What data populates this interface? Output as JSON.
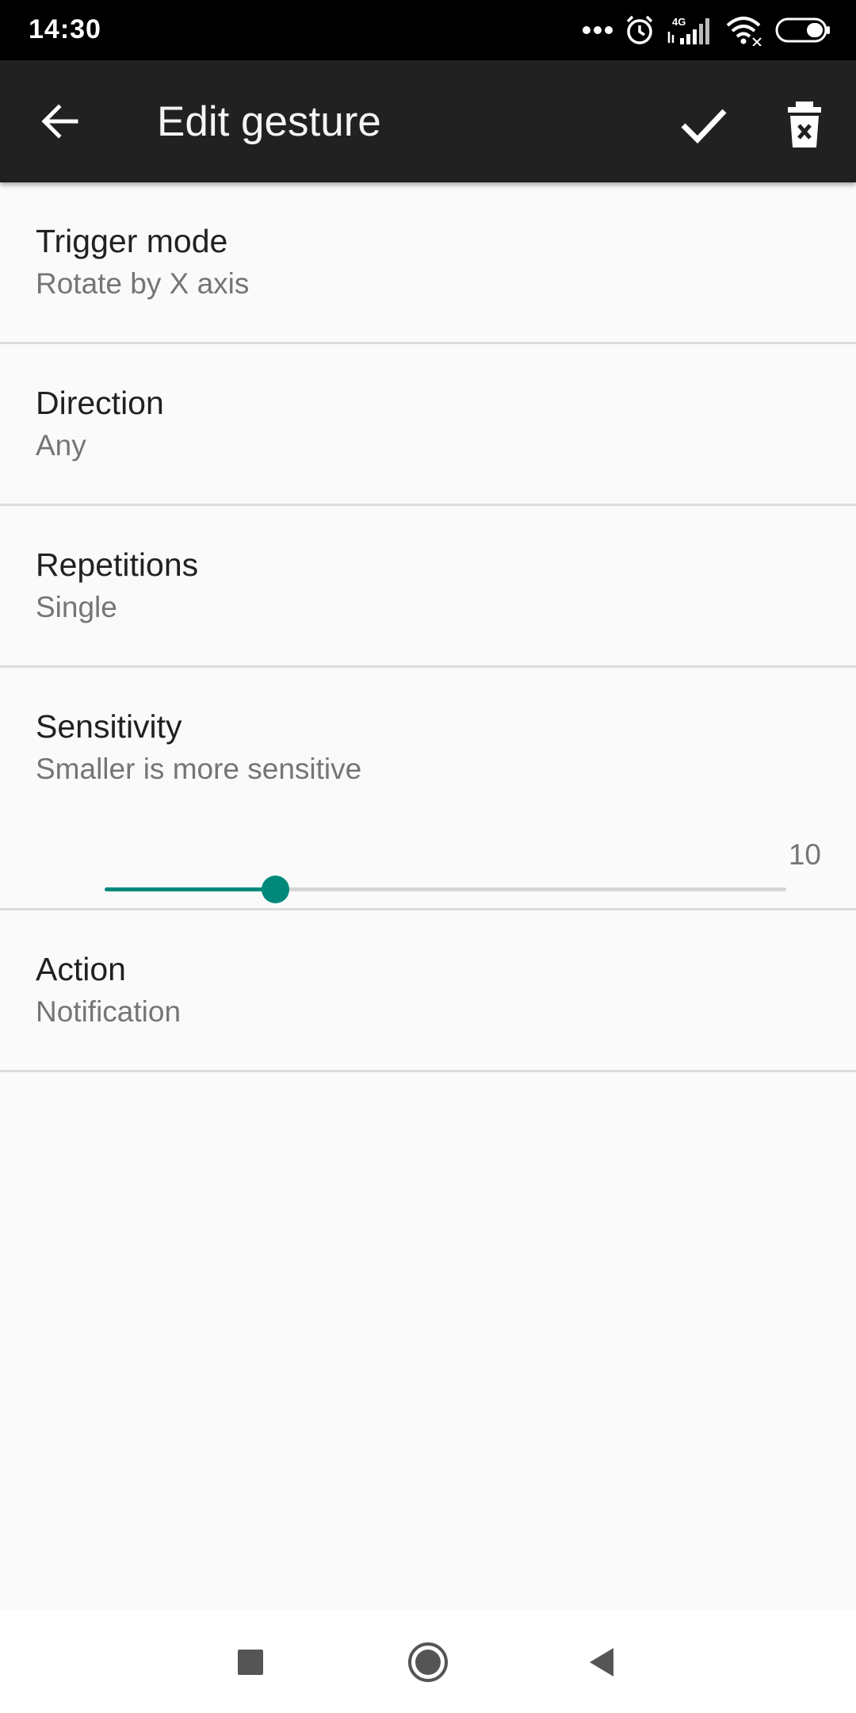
{
  "status_bar": {
    "time": "14:30",
    "network": "4G",
    "icons": [
      "more-dots-icon",
      "alarm-icon",
      "signal-icon",
      "wifi-icon",
      "battery-icon"
    ]
  },
  "app_bar": {
    "title": "Edit gesture",
    "icons": [
      "back-arrow-icon",
      "check-icon",
      "delete-icon"
    ]
  },
  "settings": {
    "trigger_mode": {
      "label": "Trigger mode",
      "value": "Rotate by X axis"
    },
    "direction": {
      "label": "Direction",
      "value": "Any"
    },
    "repetitions": {
      "label": "Repetitions",
      "value": "Single"
    },
    "sensitivity": {
      "label": "Sensitivity",
      "value": "Smaller is more sensitive",
      "slider_value": "10",
      "slider_fraction": 0.25
    },
    "action": {
      "label": "Action",
      "value": "Notification"
    }
  },
  "nav_bar": {
    "icons": [
      "recents-square-icon",
      "home-circle-icon",
      "back-triangle-icon"
    ]
  },
  "colors": {
    "accent": "#00897b",
    "app_bar": "#212121",
    "background": "#fafafa"
  }
}
